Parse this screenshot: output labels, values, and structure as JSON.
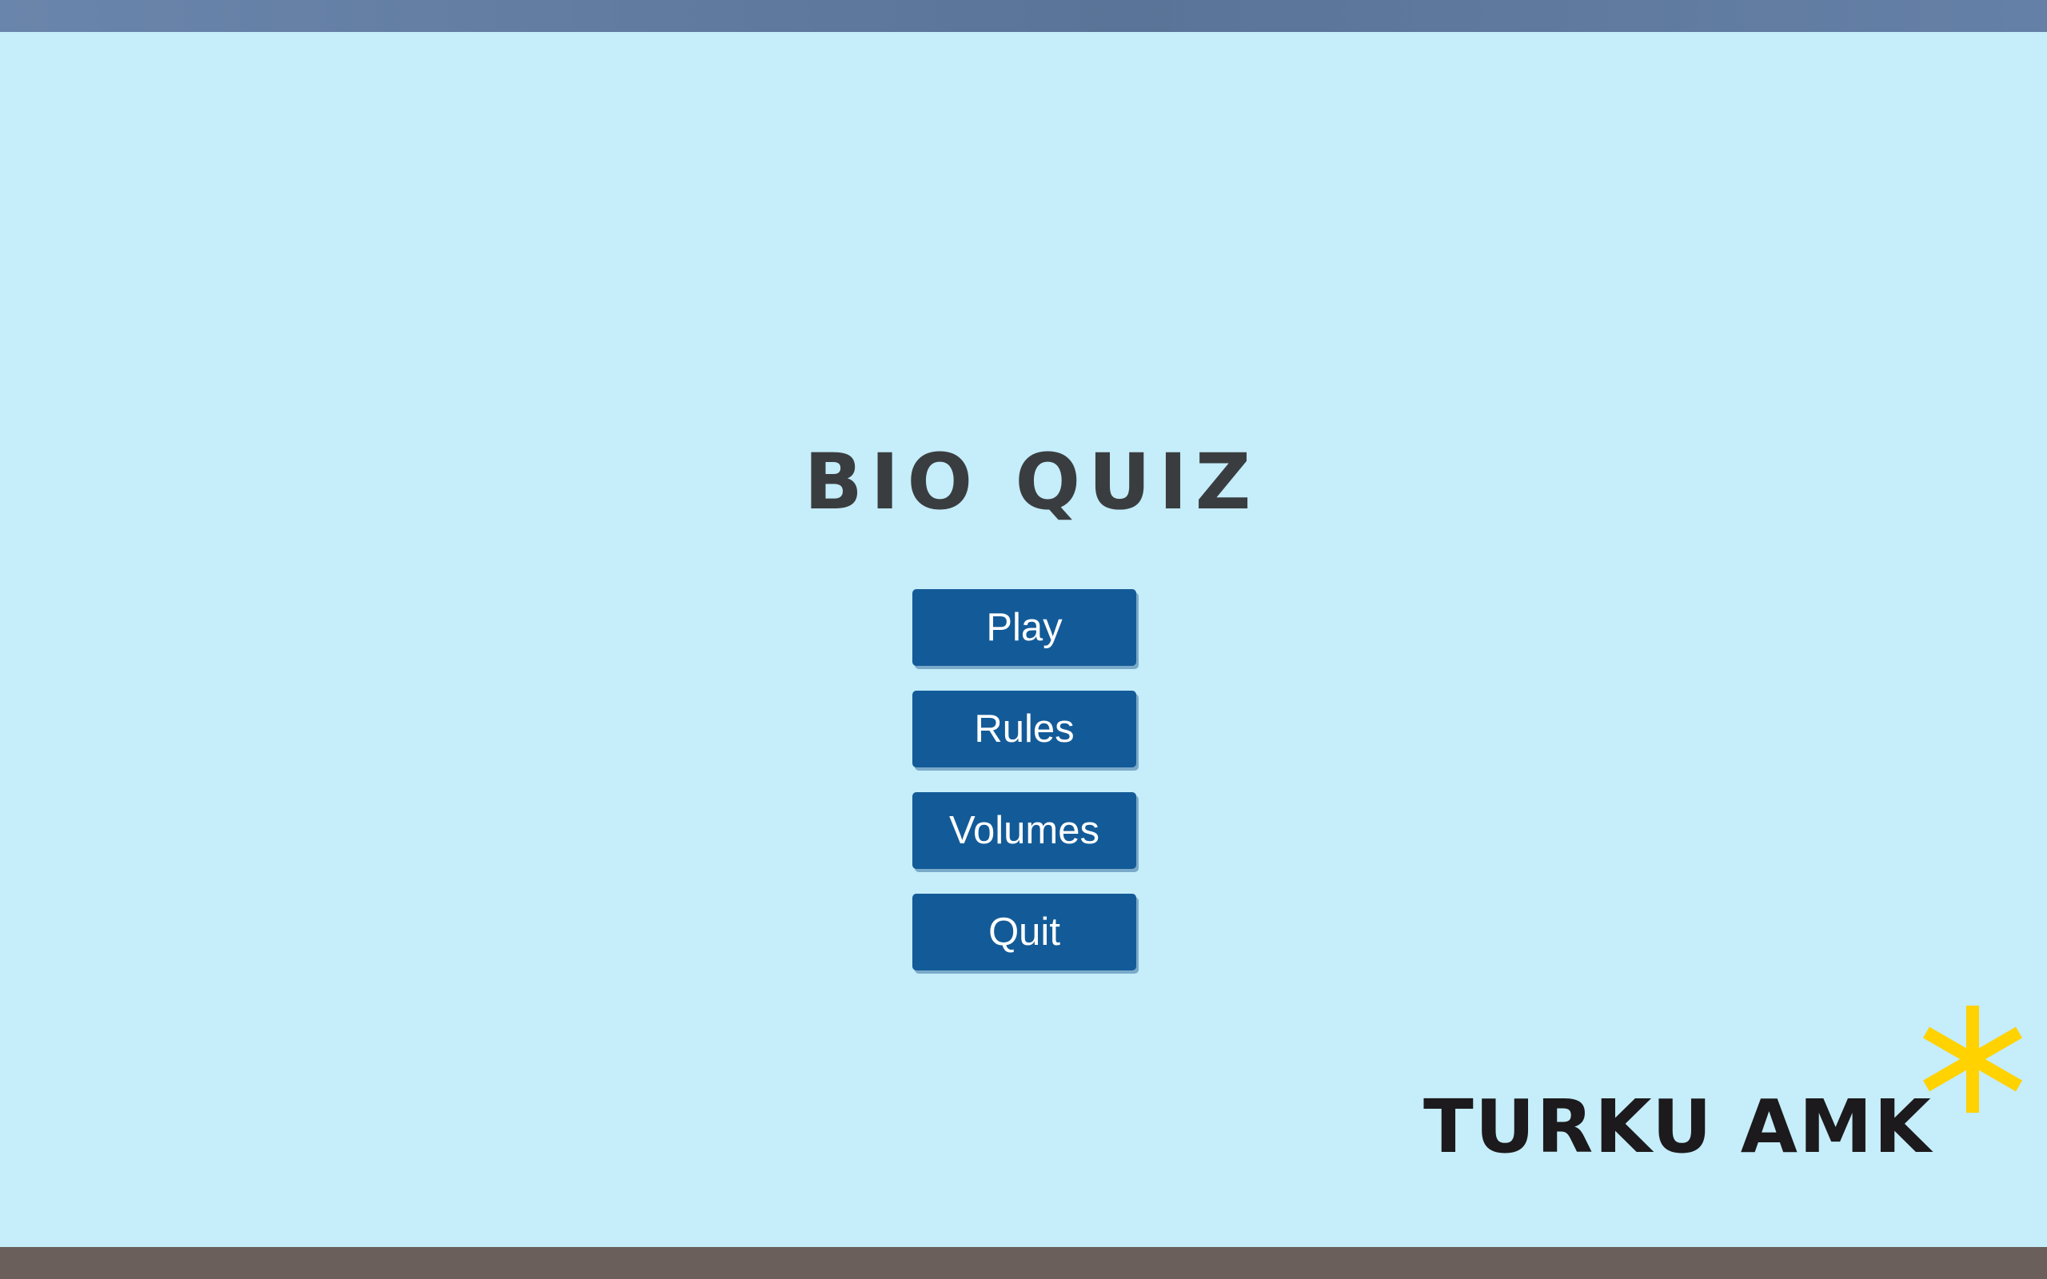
{
  "game": {
    "title": "BIO QUIZ"
  },
  "menu": {
    "buttons": [
      {
        "label": "Play"
      },
      {
        "label": "Rules"
      },
      {
        "label": "Volumes"
      },
      {
        "label": "Quit"
      }
    ]
  },
  "logo": {
    "text": "TURKU AMK",
    "star_icon": "asterisk-icon",
    "star_color": "#ffd200"
  },
  "colors": {
    "background": "#c5edfa",
    "button": "#135b98",
    "title": "#3a3d40",
    "top_bar": "#5f7aa0",
    "bottom_bar": "#6a5f5a"
  }
}
